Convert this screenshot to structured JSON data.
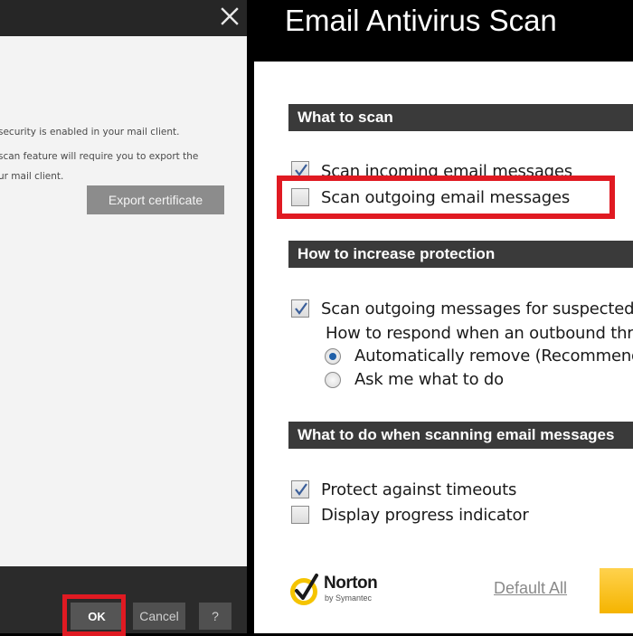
{
  "left_dialog": {
    "lines": [
      "security is enabled in your mail client.",
      "scan feature will require you to export the",
      "ur mail client."
    ],
    "export_button": "Export certificate",
    "ok_button": "OK",
    "cancel_button": "Cancel",
    "help_button": "?"
  },
  "right_window": {
    "title": "Email Antivirus Scan",
    "sections": {
      "what_to_scan": "What to scan",
      "how_to_increase": "How to increase protection",
      "what_to_do": "What to do when scanning email messages"
    },
    "options": {
      "scan_incoming": {
        "label": "Scan incoming email messages",
        "checked": true
      },
      "scan_outgoing": {
        "label": "Scan outgoing email messages",
        "checked": false
      },
      "scan_suspected": {
        "label": "Scan outgoing messages for suspected",
        "checked": true
      },
      "respond_question": "How to respond when an outbound threa",
      "auto_remove": {
        "label": "Automatically remove (Recommende",
        "selected": true
      },
      "ask_me": {
        "label": "Ask me what to do",
        "selected": false
      },
      "protect_timeouts": {
        "label": "Protect against timeouts",
        "checked": true
      },
      "display_progress": {
        "label": "Display progress indicator",
        "checked": false
      }
    },
    "footer": {
      "brand": "Norton",
      "brand_sub": "by Symantec",
      "default_all": "Default All"
    }
  },
  "colors": {
    "highlight": "#e01a22",
    "section_header_bg": "#3a3a3a",
    "radio_selected": "#1f5fa8",
    "norton_yellow": "#f5c400"
  }
}
